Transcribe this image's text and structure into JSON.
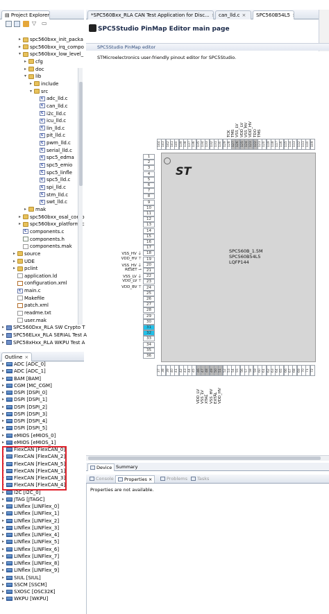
{
  "explorer": {
    "tab_label": "Project Explorer",
    "tab_close": "⨯",
    "rows": [
      {
        "name": "spc560bxx_init_packa",
        "depth": 3,
        "kind": "folder",
        "arrow": "▸"
      },
      {
        "name": "spc560bxx_irq_compo",
        "depth": 3,
        "kind": "folder",
        "arrow": "▸"
      },
      {
        "name": "spc560bxx_low_level_",
        "depth": 3,
        "kind": "folder",
        "arrow": "▾"
      },
      {
        "name": "cfg",
        "depth": 4,
        "kind": "folder",
        "arrow": "▸"
      },
      {
        "name": "doc",
        "depth": 4,
        "kind": "folder",
        "arrow": "▸"
      },
      {
        "name": "lib",
        "depth": 4,
        "kind": "folder",
        "arrow": "▾"
      },
      {
        "name": "include",
        "depth": 5,
        "kind": "folder",
        "arrow": "▸"
      },
      {
        "name": "src",
        "depth": 5,
        "kind": "folder",
        "arrow": "▾"
      },
      {
        "name": "adc_lld.c",
        "depth": 6,
        "kind": "cfile",
        "arrow": ""
      },
      {
        "name": "can_lld.c",
        "depth": 6,
        "kind": "cfile",
        "arrow": ""
      },
      {
        "name": "i2c_lld.c",
        "depth": 6,
        "kind": "cfile",
        "arrow": ""
      },
      {
        "name": "icu_lld.c",
        "depth": 6,
        "kind": "cfile",
        "arrow": ""
      },
      {
        "name": "lin_lld.c",
        "depth": 6,
        "kind": "cfile",
        "arrow": ""
      },
      {
        "name": "pit_lld.c",
        "depth": 6,
        "kind": "cfile",
        "arrow": ""
      },
      {
        "name": "pwm_lld.c",
        "depth": 6,
        "kind": "cfile",
        "arrow": ""
      },
      {
        "name": "serial_lld.c",
        "depth": 6,
        "kind": "cfile",
        "arrow": ""
      },
      {
        "name": "spc5_edma",
        "depth": 6,
        "kind": "cfile",
        "arrow": ""
      },
      {
        "name": "spc5_emio",
        "depth": 6,
        "kind": "cfile",
        "arrow": ""
      },
      {
        "name": "spc5_linfle",
        "depth": 6,
        "kind": "cfile",
        "arrow": ""
      },
      {
        "name": "spc5_lld.c",
        "depth": 6,
        "kind": "cfile",
        "arrow": ""
      },
      {
        "name": "spi_lld.c",
        "depth": 6,
        "kind": "cfile",
        "arrow": ""
      },
      {
        "name": "stm_lld.c",
        "depth": 6,
        "kind": "cfile",
        "arrow": ""
      },
      {
        "name": "swt_lld.c",
        "depth": 6,
        "kind": "cfile",
        "arrow": ""
      },
      {
        "name": "mak",
        "depth": 4,
        "kind": "folder",
        "arrow": "▸"
      },
      {
        "name": "spc560bxx_osal_comp",
        "depth": 3,
        "kind": "folder",
        "arrow": "▸"
      },
      {
        "name": "spc560bxx_platform_c",
        "depth": 3,
        "kind": "folder",
        "arrow": "▸"
      },
      {
        "name": "components.c",
        "depth": 3,
        "kind": "cfile",
        "arrow": ""
      },
      {
        "name": "components.h",
        "depth": 3,
        "kind": "hfile",
        "arrow": ""
      },
      {
        "name": "components.mak",
        "depth": 3,
        "kind": "file",
        "arrow": ""
      },
      {
        "name": "source",
        "depth": 2,
        "kind": "folder",
        "arrow": "▸"
      },
      {
        "name": "UDE",
        "depth": 2,
        "kind": "folder",
        "arrow": "▸"
      },
      {
        "name": "pclint",
        "depth": 2,
        "kind": "folder",
        "arrow": "▸"
      },
      {
        "name": "application.ld",
        "depth": 2,
        "kind": "file",
        "arrow": ""
      },
      {
        "name": "configuration.xml",
        "depth": 2,
        "kind": "xml",
        "arrow": ""
      },
      {
        "name": "main.c",
        "depth": 2,
        "kind": "cfile",
        "arrow": ""
      },
      {
        "name": "Makefile",
        "depth": 2,
        "kind": "file",
        "arrow": ""
      },
      {
        "name": "patch.xml",
        "depth": 2,
        "kind": "xml",
        "arrow": ""
      },
      {
        "name": "readme.txt",
        "depth": 2,
        "kind": "file",
        "arrow": ""
      },
      {
        "name": "user.mak",
        "depth": 2,
        "kind": "file",
        "arrow": ""
      },
      {
        "name": "SPC560Dxx_RLA SW Crypto T",
        "depth": 0,
        "kind": "proj",
        "arrow": "▸"
      },
      {
        "name": "SPC56ELxx_RLA SERIAL Test A",
        "depth": 0,
        "kind": "proj",
        "arrow": "▸"
      },
      {
        "name": "SPC58xHxx_RLA WKPU Test A",
        "depth": 0,
        "kind": "proj",
        "arrow": "▸"
      }
    ]
  },
  "outline": {
    "tab_label": "Outline",
    "tab_close": "⨯",
    "rows": [
      "ADC [ADC_0]",
      "ADC [ADC_1]",
      "BAM [BAM]",
      "CGM [MC_CGM]",
      "DSPI [DSPI_0]",
      "DSPI [DSPI_1]",
      "DSPI [DSPI_2]",
      "DSPI [DSPI_3]",
      "DSPI [DSPI_4]",
      "DSPI [DSPI_5]",
      "eMIOS [eMIOS_0]",
      "eMIOS [eMIOS_1]",
      "FlexCAN [FlexCAN_0]",
      "FlexCAN [FlexCAN_2]",
      "FlexCAN [FlexCAN_5]",
      "FlexCAN [FlexCAN_1]",
      "FlexCAN [FlexCAN_3]",
      "FlexCAN [FlexCAN_4]",
      "I2C [I2C_0]",
      "JTAG [JTAGC]",
      "LINflex [LINFlex_0]",
      "LINflex [LINFlex_1]",
      "LINflex [LINFlex_2]",
      "LINflex [LINFlex_3]",
      "LINflex [LINFlex_4]",
      "LINflex [LINFlex_5]",
      "LINflex [LINFlex_6]",
      "LINflex [LINFlex_7]",
      "LINflex [LINFlex_8]",
      "LINflex [LINFlex_9]",
      "SIUL [SIUL]",
      "SSCM [SSCM]",
      "SXOSC [OSC32K]",
      "WKPU [WKPU]"
    ]
  },
  "editor_tabs": [
    {
      "label": "*SPC560Bxx_RLA CAN Test Application for Disc...",
      "active": false
    },
    {
      "label": "can_lld.c",
      "active": false
    },
    {
      "label": "SPC560B54L5",
      "active": true
    }
  ],
  "editor": {
    "title": "SPC5Studio PinMap Editor main page",
    "section_label": "SPC5Studio PinMap editor",
    "section_desc": "STMicroelectronics user-friendly pinout editor for SPC5Studio."
  },
  "chip": {
    "logo": "ST",
    "lines": [
      "SPC560B_1.5M",
      "SPC560B54L5",
      "LQFP144"
    ],
    "left_pins": [
      "1",
      "2",
      "3",
      "4",
      "5",
      "6",
      "7",
      "8",
      "9",
      "10",
      "11",
      "12",
      "13",
      "14",
      "15",
      "16",
      "17",
      "18",
      "19",
      "20",
      "21",
      "22",
      "23",
      "24",
      "25",
      "26",
      "27",
      "28",
      "29",
      "30",
      "31",
      "32",
      "33",
      "34",
      "35",
      "36"
    ],
    "left_selected": [
      "31",
      "32"
    ],
    "left_labels": [
      {
        "pin": "18",
        "text": "VSS_HV ⏚"
      },
      {
        "pin": "19",
        "text": "VDD_HV ⊤"
      },
      {
        "pin": "20",
        "text": "VSS_HV ⏚"
      },
      {
        "pin": "21",
        "text": "RESET ⊸"
      },
      {
        "pin": "22",
        "text": "VSS_LV ⏚"
      },
      {
        "pin": "23",
        "text": "VDD_LV ⊤"
      },
      {
        "pin": "24",
        "text": "VDD_BV ⊤"
      }
    ],
    "top_pins": [
      "144",
      "143",
      "142",
      "141",
      "140",
      "139",
      "138",
      "137",
      "136",
      "135",
      "134",
      "133",
      "132",
      "131",
      "130",
      "129",
      "128",
      "127",
      "126",
      "125",
      "124",
      "123",
      "122",
      "121",
      "120",
      "119",
      "118",
      "117",
      "116",
      "115",
      "114",
      "113",
      "112",
      "111",
      "110",
      "109"
    ],
    "top_gray": [
      "127",
      "126",
      "125",
      "124",
      "123",
      "122"
    ],
    "top_labels": [
      {
        "pin": "128",
        "text": "TCK"
      },
      {
        "pin": "127",
        "text": "TMS"
      },
      {
        "pin": "126",
        "text": "VSS_LV"
      },
      {
        "pin": "125",
        "text": "VDD_LV"
      },
      {
        "pin": "124",
        "text": "VSS_HV"
      },
      {
        "pin": "123",
        "text": "VDD_HV"
      },
      {
        "pin": "122",
        "text": "TDO"
      },
      {
        "pin": "121",
        "text": "TMS"
      }
    ],
    "bottom_pins": [
      "37",
      "38",
      "39",
      "40",
      "41",
      "42",
      "43",
      "44",
      "45",
      "46",
      "47",
      "48",
      "49",
      "50",
      "51",
      "52",
      "53",
      "54",
      "55",
      "56",
      "57",
      "58",
      "59",
      "60",
      "61",
      "62",
      "63",
      "64",
      "65",
      "66",
      "67",
      "68",
      "69",
      "70",
      "71",
      "72"
    ],
    "bottom_gray": [
      "46",
      "47",
      "48",
      "49",
      "50",
      "51"
    ],
    "bottom_labels": [
      {
        "pin": "46",
        "text": "VDD_LV"
      },
      {
        "pin": "47",
        "text": "VSS_LV"
      },
      {
        "pin": "48",
        "text": "XTAL"
      },
      {
        "pin": "49",
        "text": "VSS_HV"
      },
      {
        "pin": "50",
        "text": "EXTAL"
      },
      {
        "pin": "51",
        "text": "VDD_HV"
      }
    ]
  },
  "bottom_tabs": [
    {
      "label": "Device",
      "active": true
    },
    {
      "label": "Summary",
      "active": false
    }
  ],
  "properties": {
    "tabs": [
      {
        "label": "Console",
        "active": false,
        "dim": true
      },
      {
        "label": "Properties",
        "active": true,
        "dim": false
      },
      {
        "label": "Problems",
        "active": false,
        "dim": true
      },
      {
        "label": "Tasks",
        "active": false,
        "dim": true
      }
    ],
    "message": "Properties are not available."
  },
  "colors": {
    "selected_pin": "#23c0e8",
    "highlight_box": "#e0212b"
  }
}
